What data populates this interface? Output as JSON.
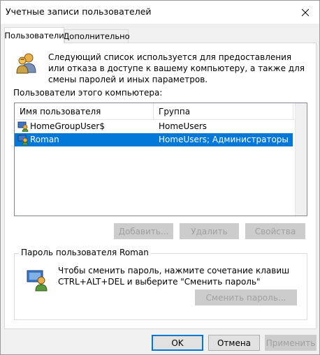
{
  "window": {
    "title": "Учетные записи пользователей"
  },
  "tabs": [
    {
      "label": "Пользователи",
      "active": true
    },
    {
      "label": "Дополнительно",
      "active": false
    }
  ],
  "intro": {
    "text": "Следующий список используется для предоставления или отказа в доступе к вашему компьютеру, а также для смены паролей и иных параметров."
  },
  "users_list": {
    "label": "Пользователи этого компьютера:",
    "columns": [
      "Имя пользователя",
      "Группа"
    ],
    "rows": [
      {
        "name": "HomeGroupUser$",
        "group": "HomeUsers",
        "selected": false
      },
      {
        "name": "Roman",
        "group": "HomeUsers; Администраторы",
        "selected": true
      }
    ]
  },
  "list_buttons": {
    "add": "Добавить...",
    "remove": "Удалить",
    "properties": "Свойства"
  },
  "password_group": {
    "title": "Пароль пользователя Roman",
    "text": "Чтобы сменить пароль, нажмите сочетание клавиш CTRL+ALT+DEL и выберите \"Сменить пароль\"",
    "change_button": "Сменить пароль..."
  },
  "footer": {
    "ok": "OK",
    "cancel": "Отмена",
    "apply": "Применить"
  },
  "colors": {
    "selection": "#0078d7",
    "window_bg": "#f0f0f0",
    "panel_bg": "#ffffff",
    "disabled_text": "#a0a0a0"
  }
}
